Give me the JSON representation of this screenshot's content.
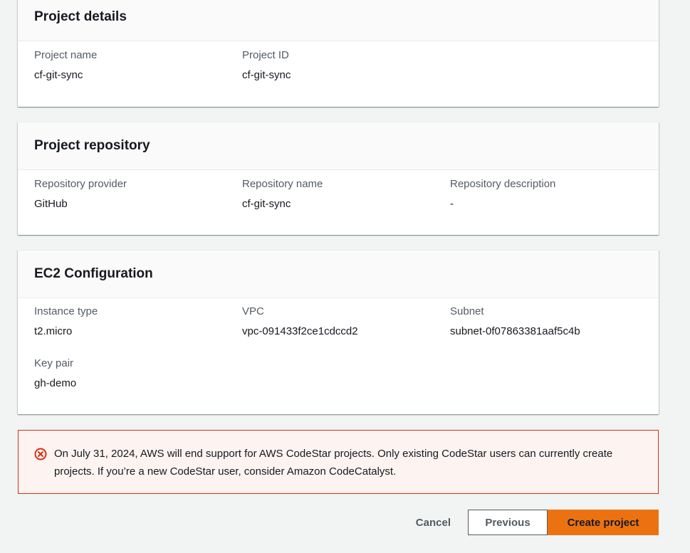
{
  "project_details": {
    "title": "Project details",
    "fields": [
      {
        "label": "Project name",
        "value": "cf-git-sync"
      },
      {
        "label": "Project ID",
        "value": "cf-git-sync"
      }
    ]
  },
  "project_repository": {
    "title": "Project repository",
    "fields": [
      {
        "label": "Repository provider",
        "value": "GitHub"
      },
      {
        "label": "Repository name",
        "value": "cf-git-sync"
      },
      {
        "label": "Repository description",
        "value": "-"
      }
    ]
  },
  "ec2_configuration": {
    "title": "EC2 Configuration",
    "fields": [
      {
        "label": "Instance type",
        "value": "t2.micro"
      },
      {
        "label": "VPC",
        "value": "vpc-091433f2ce1cdccd2"
      },
      {
        "label": "Subnet",
        "value": "subnet-0f07863381aaf5c4b"
      },
      {
        "label": "Key pair",
        "value": "gh-demo"
      }
    ]
  },
  "alert": {
    "icon": "error-circle-icon",
    "color": "#d13212",
    "text": "On July 31, 2024, AWS will end support for AWS CodeStar projects. Only existing CodeStar users can currently create projects. If you’re a new CodeStar user, consider Amazon CodeCatalyst."
  },
  "actions": {
    "cancel_label": "Cancel",
    "previous_label": "Previous",
    "create_label": "Create project"
  },
  "colors": {
    "primary_button": "#ec7211",
    "alert_border": "#d13212",
    "alert_background": "#fdf3f1"
  }
}
